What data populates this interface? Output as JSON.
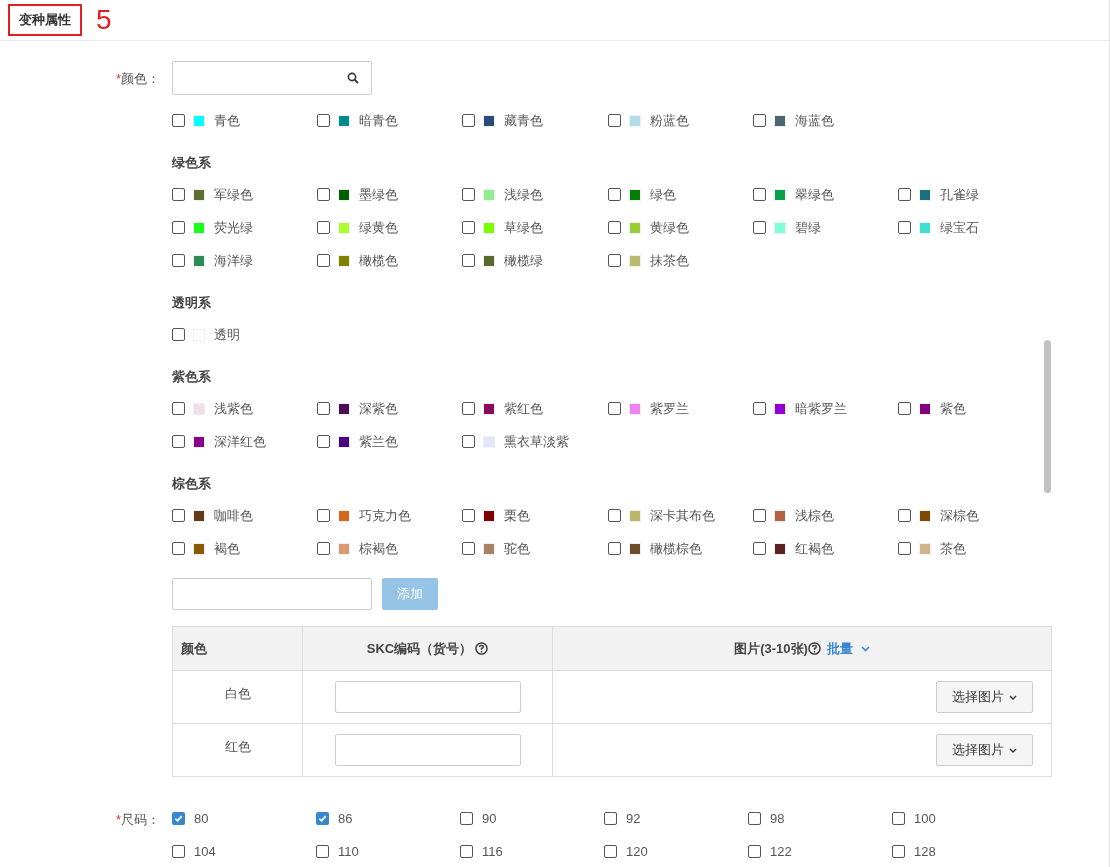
{
  "section": {
    "title": "变种属性",
    "annotation": "5"
  },
  "color_field": {
    "required_mark": "*",
    "label": "颜色："
  },
  "color_groups": [
    {
      "items": [
        {
          "name": "青色",
          "color": "#00ffff",
          "checked": false
        },
        {
          "name": "暗青色",
          "color": "#008b8b",
          "checked": false
        },
        {
          "name": "藏青色",
          "color": "#2b4a7c",
          "checked": false
        },
        {
          "name": "粉蓝色",
          "color": "#b0dde6",
          "checked": false
        },
        {
          "name": "海蓝色",
          "color": "#4d6670",
          "checked": false
        }
      ]
    },
    {
      "title": "绿色系",
      "items": [
        {
          "name": "军绿色",
          "color": "#5b7031",
          "checked": false
        },
        {
          "name": "墨绿色",
          "color": "#005f00",
          "checked": false
        },
        {
          "name": "浅绿色",
          "color": "#90ee90",
          "checked": false
        },
        {
          "name": "绿色",
          "color": "#008000",
          "checked": false
        },
        {
          "name": "翠绿色",
          "color": "#0aa04a",
          "checked": false
        },
        {
          "name": "孔雀绿",
          "color": "#1b6e7e",
          "checked": false
        },
        {
          "name": "荧光绿",
          "color": "#1aff1a",
          "checked": false
        },
        {
          "name": "绿黄色",
          "color": "#adff2f",
          "checked": false
        },
        {
          "name": "草绿色",
          "color": "#7cfc00",
          "checked": false
        },
        {
          "name": "黄绿色",
          "color": "#9acd32",
          "checked": false
        },
        {
          "name": "碧绿",
          "color": "#7fffd4",
          "checked": false
        },
        {
          "name": "绿宝石",
          "color": "#40e0d0",
          "checked": false
        },
        {
          "name": "海洋绿",
          "color": "#2e8b57",
          "checked": false
        },
        {
          "name": "橄榄色",
          "color": "#808000",
          "checked": false
        },
        {
          "name": "橄榄绿",
          "color": "#556b2f",
          "checked": false
        },
        {
          "name": "抹茶色",
          "color": "#b8bb6e",
          "checked": false
        }
      ]
    },
    {
      "title": "透明系",
      "items": [
        {
          "name": "透明",
          "color": "#ffffff",
          "checked": false
        }
      ]
    },
    {
      "title": "紫色系",
      "items": [
        {
          "name": "浅紫色",
          "color": "#ede0e8",
          "checked": false
        },
        {
          "name": "深紫色",
          "color": "#4b0e55",
          "checked": false
        },
        {
          "name": "紫红色",
          "color": "#8b0a5e",
          "checked": false
        },
        {
          "name": "紫罗兰",
          "color": "#ee82ee",
          "checked": false
        },
        {
          "name": "暗紫罗兰",
          "color": "#9400d3",
          "checked": false
        },
        {
          "name": "紫色",
          "color": "#800080",
          "checked": false
        },
        {
          "name": "深洋红色",
          "color": "#8b008b",
          "checked": false
        },
        {
          "name": "紫兰色",
          "color": "#4b0082",
          "checked": false
        },
        {
          "name": "熏衣草淡紫",
          "color": "#e6e6fa",
          "checked": false
        }
      ]
    },
    {
      "title": "棕色系",
      "items": [
        {
          "name": "咖啡色",
          "color": "#623a17",
          "checked": false
        },
        {
          "name": "巧克力色",
          "color": "#d2691e",
          "checked": false
        },
        {
          "name": "栗色",
          "color": "#800000",
          "checked": false
        },
        {
          "name": "深卡其布色",
          "color": "#bdb76b",
          "checked": false
        },
        {
          "name": "浅棕色",
          "color": "#b5614a",
          "checked": false
        },
        {
          "name": "深棕色",
          "color": "#7b4a00",
          "checked": false
        },
        {
          "name": "褐色",
          "color": "#8b5a00",
          "checked": false
        },
        {
          "name": "棕褐色",
          "color": "#dc9670",
          "checked": false
        },
        {
          "name": "驼色",
          "color": "#a98361",
          "checked": false
        },
        {
          "name": "橄榄棕色",
          "color": "#6b4c2b",
          "checked": false
        },
        {
          "name": "红褐色",
          "color": "#5c2223",
          "checked": false
        },
        {
          "name": "茶色",
          "color": "#d2b48c",
          "checked": false
        }
      ]
    }
  ],
  "add_color": {
    "button": "添加",
    "disabled": true
  },
  "table": {
    "columns": [
      "颜色",
      "SKC编码（货号）",
      "图片(3-10张)"
    ],
    "batch_link": "批量",
    "rows": [
      {
        "name": "白色",
        "button": "选择图片"
      },
      {
        "name": "红色",
        "button": "选择图片"
      }
    ]
  },
  "size_field": {
    "required_mark": "*",
    "label": "尺码：",
    "items": [
      {
        "label": "80",
        "checked": true
      },
      {
        "label": "86",
        "checked": true
      },
      {
        "label": "90",
        "checked": false
      },
      {
        "label": "92",
        "checked": false
      },
      {
        "label": "98",
        "checked": false
      },
      {
        "label": "100",
        "checked": false
      },
      {
        "label": "104",
        "checked": false
      },
      {
        "label": "110",
        "checked": false
      },
      {
        "label": "116",
        "checked": false
      },
      {
        "label": "120",
        "checked": false
      },
      {
        "label": "122",
        "checked": false
      },
      {
        "label": "128",
        "checked": false
      }
    ]
  }
}
